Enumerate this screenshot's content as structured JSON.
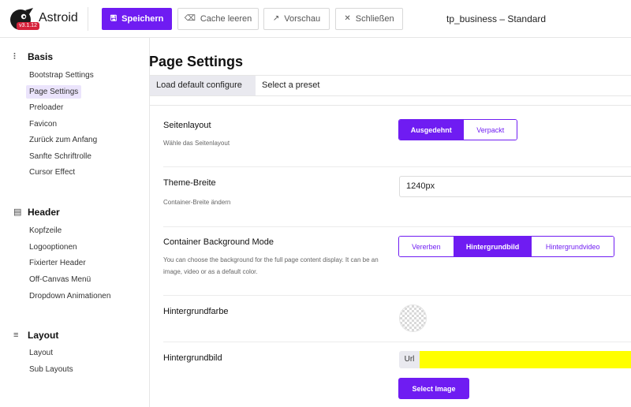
{
  "app": {
    "name": "Astroid",
    "version": "v3.1.12",
    "template_title": "tp_business – Standard"
  },
  "toolbar": {
    "save": "Speichern",
    "cache": "Cache leeren",
    "preview": "Vorschau",
    "close": "Schließen"
  },
  "sidebar": {
    "sections": [
      {
        "title": "Basis",
        "icon": "sliders-icon",
        "items": [
          {
            "label": "Bootstrap Settings"
          },
          {
            "label": "Page Settings",
            "active": true
          },
          {
            "label": "Preloader"
          },
          {
            "label": "Favicon"
          },
          {
            "label": "Zurück zum Anfang"
          },
          {
            "label": "Sanfte Schriftrolle"
          },
          {
            "label": "Cursor Effect"
          }
        ]
      },
      {
        "title": "Header",
        "icon": "header-layout-icon",
        "items": [
          {
            "label": "Kopfzeile"
          },
          {
            "label": "Logooptionen"
          },
          {
            "label": "Fixierter Header"
          },
          {
            "label": "Off-Canvas Menü"
          },
          {
            "label": "Dropdown Animationen"
          }
        ]
      },
      {
        "title": "Layout",
        "icon": "layers-icon",
        "items": [
          {
            "label": "Layout"
          },
          {
            "label": "Sub Layouts"
          }
        ]
      }
    ]
  },
  "main": {
    "title": "Page Settings",
    "tabs": [
      {
        "label": "Load default configure",
        "active": true
      },
      {
        "label": "Select a preset"
      }
    ],
    "fields": {
      "layout": {
        "title": "Seitenlayout",
        "desc": "Wähle das Seitenlayout",
        "options": [
          "Ausgedehnt",
          "Verpackt"
        ],
        "selected": "Ausgedehnt"
      },
      "width": {
        "title": "Theme-Breite",
        "desc": "Container-Breite ändern",
        "value": "1240px"
      },
      "bgmode": {
        "title": "Container Background Mode",
        "desc": "You can choose the background for the full page content display. It can be an image, video or as a default color.",
        "options": [
          "Vererben",
          "Hintergrundbild",
          "Hintergrundvideo"
        ],
        "selected": "Hintergrundbild"
      },
      "bgcolor": {
        "title": "Hintergrundfarbe"
      },
      "bgimage": {
        "title": "Hintergrundbild",
        "prefix": "Url",
        "value": "",
        "button": "Select Image"
      }
    }
  },
  "colors": {
    "accent": "#6f1cf2",
    "highlight": "#ffff00",
    "active_nav": "#ebe4fc",
    "version_badge": "#d6223b"
  }
}
